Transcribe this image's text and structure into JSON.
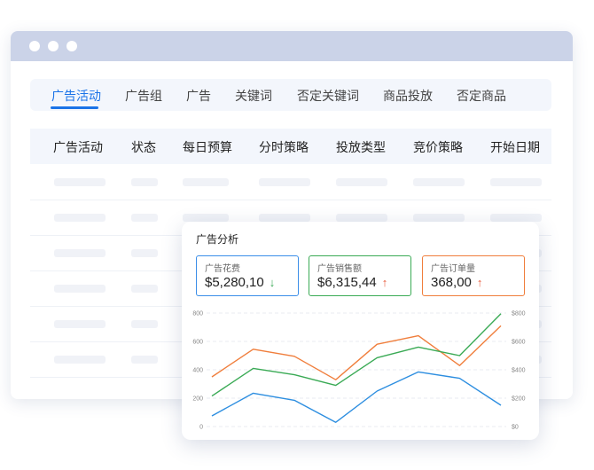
{
  "tabs": [
    {
      "label": "广告活动",
      "active": true
    },
    {
      "label": "广告组"
    },
    {
      "label": "广告"
    },
    {
      "label": "关键词"
    },
    {
      "label": "否定关键词"
    },
    {
      "label": "商品投放"
    },
    {
      "label": "否定商品"
    }
  ],
  "table": {
    "columns": [
      "广告活动",
      "状态",
      "每日预算",
      "分时策略",
      "投放类型",
      "竞价策略",
      "开始日期"
    ]
  },
  "card": {
    "title": "广告分析",
    "metrics": [
      {
        "label": "广告花费",
        "value": "$5,280,10",
        "trend": "down",
        "arrow": "↓",
        "color": "#3b8ee8",
        "arrow_color": "#3aaa55"
      },
      {
        "label": "广告销售额",
        "value": "$6,315,44",
        "trend": "up",
        "arrow": "↑",
        "color": "#3aaa55",
        "arrow_color": "#e85c3c"
      },
      {
        "label": "广告订单量",
        "value": "368,00",
        "trend": "up",
        "arrow": "↑",
        "color": "#f07e3c",
        "arrow_color": "#e85c3c"
      }
    ]
  },
  "chart_data": {
    "type": "line",
    "x": [
      1,
      2,
      3,
      4,
      5,
      6,
      7,
      8
    ],
    "left_ticks": [
      "0",
      "200",
      "400",
      "600",
      "800"
    ],
    "right_ticks": [
      "$0",
      "$200",
      "$400",
      "$600",
      "$800"
    ],
    "ylim": [
      0,
      800
    ],
    "grid": true,
    "series": [
      {
        "color": "#f07e3c",
        "values": [
          350,
          545,
          495,
          330,
          580,
          640,
          430,
          710
        ]
      },
      {
        "color": "#3aaa55",
        "values": [
          215,
          410,
          365,
          290,
          485,
          560,
          500,
          795
        ]
      },
      {
        "color": "#2d8ee0",
        "values": [
          75,
          235,
          185,
          30,
          250,
          385,
          340,
          150
        ]
      }
    ]
  }
}
